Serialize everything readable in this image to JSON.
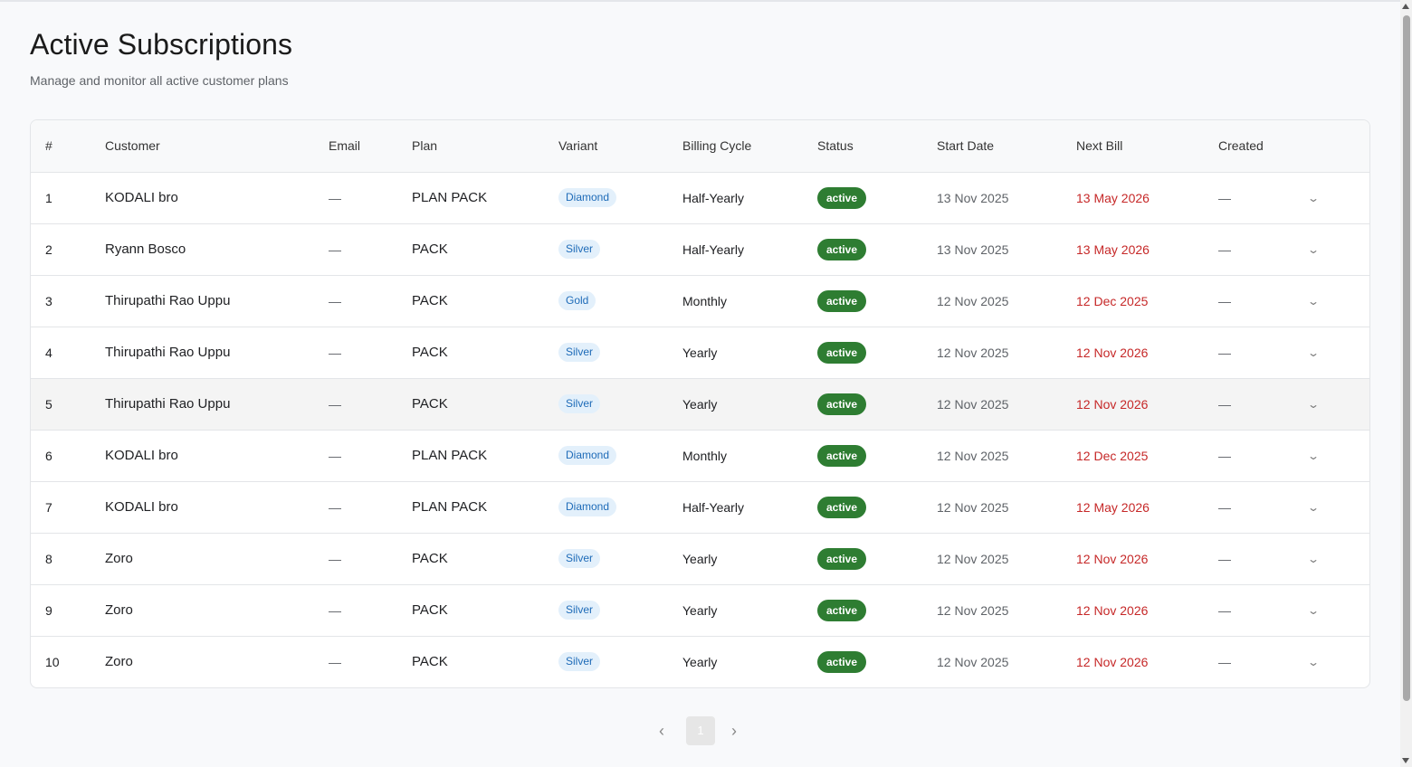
{
  "page": {
    "title": "Active Subscriptions",
    "subtitle": "Manage and monitor all active customer plans"
  },
  "table": {
    "columns": [
      "#",
      "Customer",
      "Email",
      "Plan",
      "Variant",
      "Billing Cycle",
      "Status",
      "Start Date",
      "Next Bill",
      "Created"
    ],
    "rows": [
      {
        "num": "1",
        "customer": "KODALI bro",
        "email": "—",
        "plan": "PLAN PACK",
        "variant": "Diamond",
        "cycle": "Half-Yearly",
        "status": "active",
        "start": "13 Nov 2025",
        "next": "13 May 2026",
        "created": "—"
      },
      {
        "num": "2",
        "customer": "Ryann Bosco",
        "email": "—",
        "plan": "PACK",
        "variant": "Silver",
        "cycle": "Half-Yearly",
        "status": "active",
        "start": "13 Nov 2025",
        "next": "13 May 2026",
        "created": "—"
      },
      {
        "num": "3",
        "customer": "Thirupathi Rao Uppu",
        "email": "—",
        "plan": "PACK",
        "variant": "Gold",
        "cycle": "Monthly",
        "status": "active",
        "start": "12 Nov 2025",
        "next": "12 Dec 2025",
        "created": "—"
      },
      {
        "num": "4",
        "customer": "Thirupathi Rao Uppu",
        "email": "—",
        "plan": "PACK",
        "variant": "Silver",
        "cycle": "Yearly",
        "status": "active",
        "start": "12 Nov 2025",
        "next": "12 Nov 2026",
        "created": "—"
      },
      {
        "num": "5",
        "customer": "Thirupathi Rao Uppu",
        "email": "—",
        "plan": "PACK",
        "variant": "Silver",
        "cycle": "Yearly",
        "status": "active",
        "start": "12 Nov 2025",
        "next": "12 Nov 2026",
        "created": "—"
      },
      {
        "num": "6",
        "customer": "KODALI bro",
        "email": "—",
        "plan": "PLAN PACK",
        "variant": "Diamond",
        "cycle": "Monthly",
        "status": "active",
        "start": "12 Nov 2025",
        "next": "12 Dec 2025",
        "created": "—"
      },
      {
        "num": "7",
        "customer": "KODALI bro",
        "email": "—",
        "plan": "PLAN PACK",
        "variant": "Diamond",
        "cycle": "Half-Yearly",
        "status": "active",
        "start": "12 Nov 2025",
        "next": "12 May 2026",
        "created": "—"
      },
      {
        "num": "8",
        "customer": "Zoro",
        "email": "—",
        "plan": "PACK",
        "variant": "Silver",
        "cycle": "Yearly",
        "status": "active",
        "start": "12 Nov 2025",
        "next": "12 Nov 2026",
        "created": "—"
      },
      {
        "num": "9",
        "customer": "Zoro",
        "email": "—",
        "plan": "PACK",
        "variant": "Silver",
        "cycle": "Yearly",
        "status": "active",
        "start": "12 Nov 2025",
        "next": "12 Nov 2026",
        "created": "—"
      },
      {
        "num": "10",
        "customer": "Zoro",
        "email": "—",
        "plan": "PACK",
        "variant": "Silver",
        "cycle": "Yearly",
        "status": "active",
        "start": "12 Nov 2025",
        "next": "12 Nov 2026",
        "created": "—"
      }
    ]
  },
  "pagination": {
    "current_page": "1"
  },
  "icons": {
    "row_expand": "chevron-down-icon",
    "prev": "chevron-left-icon",
    "next": "chevron-right-icon"
  },
  "colors": {
    "status_active": "#2e7d32",
    "next_bill": "#c62828",
    "variant_chip_bg": "#e3f0fb",
    "variant_chip_text": "#1e6bb8"
  }
}
